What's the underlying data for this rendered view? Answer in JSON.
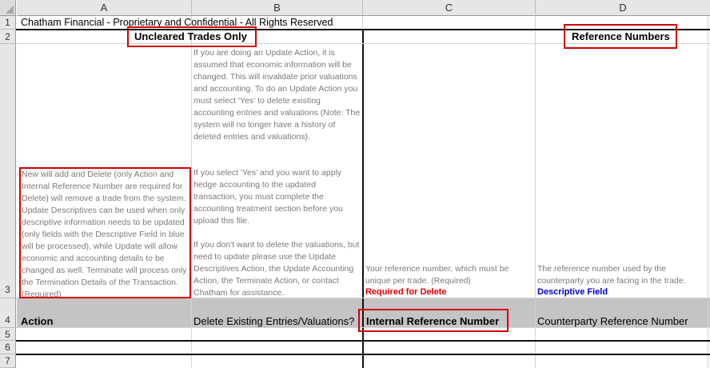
{
  "columns": [
    "A",
    "B",
    "C",
    "D"
  ],
  "rows": [
    "1",
    "2",
    "3",
    "4",
    "5",
    "6",
    "7"
  ],
  "row1": {
    "title": "Chatham Financial - Proprietary and Confidential - All Rights Reserved"
  },
  "row2": {
    "uncleared": "Uncleared Trades Only",
    "reference": "Reference Numbers"
  },
  "row3": {
    "a_note": "New will add and Delete (only Action and Internal Reference Number are required for Delete) will remove a trade from the system. Update Descriptives can be used when only descriptive information needs to be updated (only fields with the Descriptive Field in blue will be processed), while Update will allow economic and accounting details to be changed as well. Terminate will process only the Termination Details of the Transaction. (Required)",
    "b_note_1": "If you are doing an Update Action, it is assumed that economic information will be changed. This will invalidate prior valuations and accounting. To do an Update Action you must select 'Yes' to delete existing accounting entries and valuations (Note: The system will no longer have a history of deleted entries and valuations).",
    "b_note_2": "If you select 'Yes' and you want to apply hedge accounting to the updated transaction, you must complete the accounting treatment section before you upload this file.",
    "b_note_3": "If you don't want to delete the valuations, but need to update please use the Update Descriptives Action, the Update Accounting Action, the Terminate Action, or contact Chatham for assistance.",
    "c_note": "Your reference number, which must be unique per trade. (Required)",
    "c_flag": "Required for Delete",
    "d_note": "The reference number used by the counterparty you are facing in the trade.",
    "d_flag": "Descriptive Field"
  },
  "row4": {
    "a": "Action",
    "b": "Delete Existing Entries/Valuations?",
    "c": "Internal Reference Number",
    "d": "Counterparty Reference Number"
  },
  "colors": {
    "highlight": "#d10000",
    "required": "#e00000",
    "descriptive": "#0000cc",
    "header_fill": "#c6c3c6"
  }
}
